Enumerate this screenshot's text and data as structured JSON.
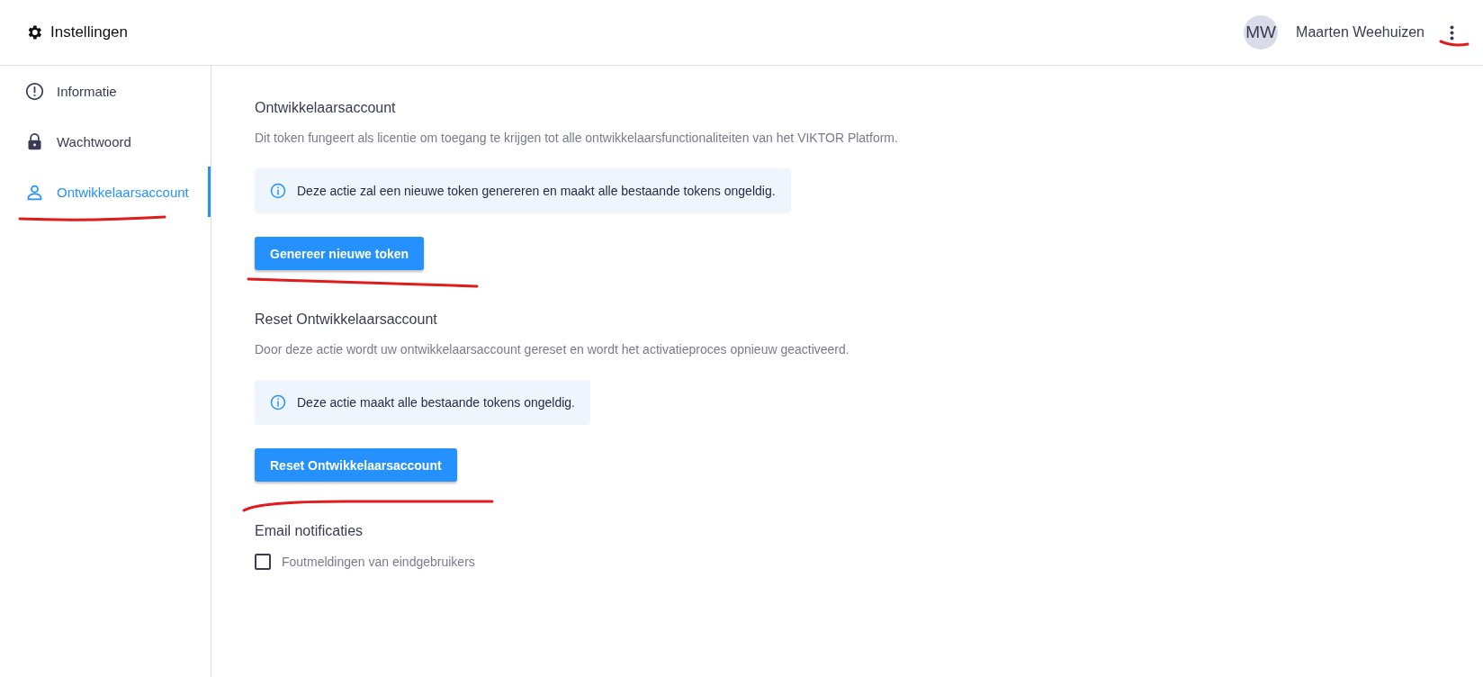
{
  "header": {
    "title": "Instellingen",
    "user": {
      "initials": "MW",
      "name": "Maarten Weehuizen"
    }
  },
  "sidebar": {
    "items": [
      {
        "label": "Informatie",
        "kind": "info",
        "selected": false
      },
      {
        "label": "Wachtwoord",
        "kind": "lock",
        "selected": false
      },
      {
        "label": "Ontwikkelaarsaccount",
        "kind": "person",
        "selected": true
      }
    ]
  },
  "sections": [
    {
      "kind": "action",
      "heading": "Ontwikkelaarsaccount",
      "description": "Dit token fungeert als licentie om toegang te krijgen tot alle ontwikkelaarsfunctionaliteiten van het VIKTOR Platform.",
      "note": "Deze actie zal een nieuwe token genereren en maakt alle bestaande tokens ongeldig.",
      "button": "Genereer nieuwe token"
    },
    {
      "kind": "action",
      "heading": "Reset Ontwikkelaarsaccount",
      "description": "Door deze actie wordt uw ontwikkelaarsaccount gereset en wordt het activatieproces opnieuw geactiveerd.",
      "note": "Deze actie maakt alle bestaande tokens ongeldig.",
      "button": "Reset Ontwikkelaarsaccount"
    },
    {
      "kind": "checkboxes",
      "heading": "Email notificaties",
      "options": [
        {
          "label": "Foutmeldingen van eindgebruikers",
          "checked": false
        }
      ]
    }
  ]
}
